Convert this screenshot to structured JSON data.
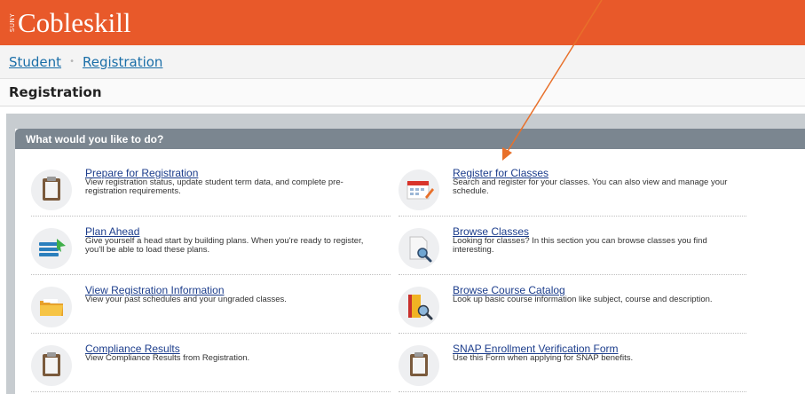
{
  "header": {
    "logo_small": "SUNY",
    "logo_text": "Cobleskill"
  },
  "breadcrumb": {
    "items": [
      "Student",
      "Registration"
    ],
    "separator": "•"
  },
  "page_title": "Registration",
  "panel": {
    "header": "What would you like to do?"
  },
  "actions": [
    {
      "label": "Prepare for Registration",
      "description": "View registration status, update student term data, and complete pre-registration requirements.",
      "icon": "clipboard-icon"
    },
    {
      "label": "Register for Classes",
      "description": "Search and register for your classes. You can also view and manage your schedule.",
      "icon": "calendar-edit-icon"
    },
    {
      "label": "Plan Ahead",
      "description": "Give yourself a head start by building plans. When you're ready to register, you'll be able to load these plans.",
      "icon": "plan-list-icon"
    },
    {
      "label": "Browse Classes",
      "description": "Looking for classes? In this section you can browse classes you find interesting.",
      "icon": "document-search-icon"
    },
    {
      "label": "View Registration Information",
      "description": "View your past schedules and your ungraded classes.",
      "icon": "folder-icon"
    },
    {
      "label": "Browse Course Catalog",
      "description": "Look up basic course information like subject, course and description.",
      "icon": "book-search-icon"
    },
    {
      "label": "Compliance Results",
      "description": "View Compliance Results from Registration.",
      "icon": "clipboard-icon"
    },
    {
      "label": "SNAP Enrollment Verification Form",
      "description": "Use this Form when applying for SNAP benefits.",
      "icon": "clipboard-icon"
    }
  ],
  "colors": {
    "header_bg": "#e8592a",
    "panel_header_bg": "#7b8690",
    "link": "#1c3d8c",
    "arrow": "#e8702a"
  }
}
